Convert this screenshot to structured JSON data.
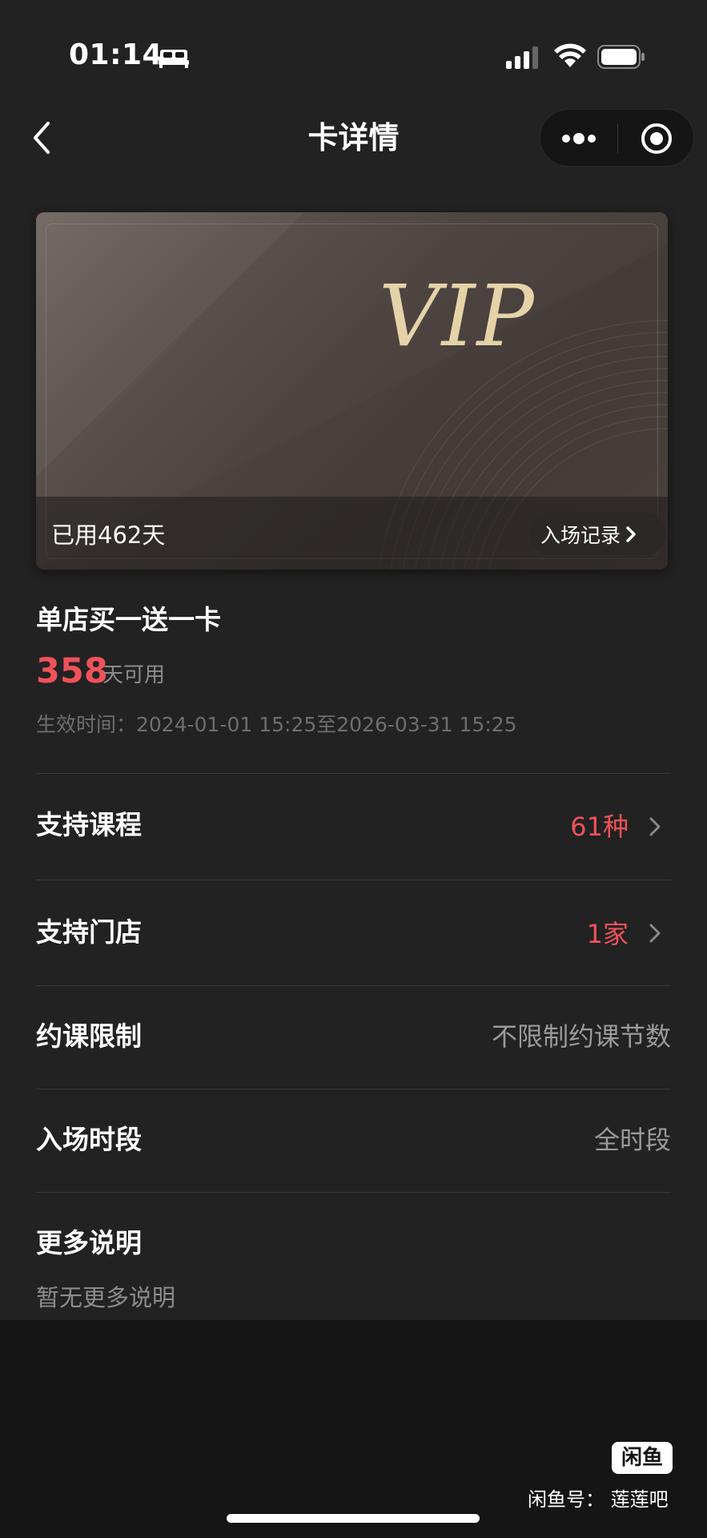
{
  "status_bar": {
    "time": "01:14",
    "icons": [
      "sleep-bed-icon",
      "signal-icon",
      "wifi-icon",
      "battery-icon"
    ]
  },
  "nav": {
    "back_icon": "chevron-left-icon",
    "title": "卡详情",
    "capsule_icons": [
      "more-dots-icon",
      "close-target-icon"
    ]
  },
  "card": {
    "logo_text": "VIP",
    "used_days": "已用462天",
    "entry_record_label": "入场记录",
    "logo_color": "#e5d2a8"
  },
  "info": {
    "card_name": "单店买一送一卡",
    "days_left": "358",
    "days_left_unit": "天可用",
    "valid_period": "生效时间：2024-01-01 15:25至2026-03-31 15:25"
  },
  "rows": [
    {
      "label": "支持课程",
      "value": "61种",
      "clickable": true
    },
    {
      "label": "支持门店",
      "value": "1家",
      "clickable": true
    },
    {
      "label": "约课限制",
      "value": "不限制约课节数",
      "clickable": false
    },
    {
      "label": "入场时段",
      "value": "全时段",
      "clickable": false
    }
  ],
  "more": {
    "title": "更多说明",
    "text": "暂无更多说明"
  },
  "watermark": {
    "logo_text": "闲鱼",
    "text": "闲鱼号：  莲莲吧"
  },
  "colors": {
    "accent_red": "#f0525a",
    "background": "#222222"
  }
}
